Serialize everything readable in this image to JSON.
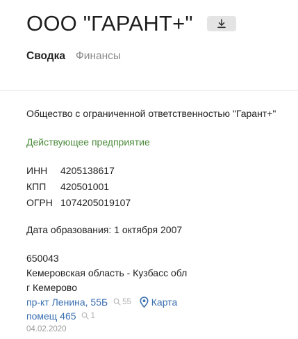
{
  "company": {
    "title": "ООО \"ГАРАНТ+\"",
    "download_icon": "download-icon"
  },
  "tabs": [
    {
      "label": "Сводка",
      "active": true
    },
    {
      "label": "Финансы",
      "active": false
    }
  ],
  "summary": {
    "full_name": "Общество с ограниченной ответственностью \"Гарант+\"",
    "status": "Действующее предприятие",
    "status_color": "#4a8a3a",
    "registration": [
      {
        "key": "ИНН",
        "value": "4205138617"
      },
      {
        "key": "КПП",
        "value": "420501001"
      },
      {
        "key": "ОГРН",
        "value": "1074205019107"
      }
    ],
    "founded": "Дата образования: 1 октября 2007"
  },
  "address": {
    "zip": "650043",
    "region": "Кемеровская область - Кузбасс обл",
    "city": "г Кемерово",
    "street": "пр-кт Ленина, 55Б",
    "street_count": "55",
    "map_label": "Карта",
    "office": "помещ 465",
    "office_count": "1",
    "date": "04.02.2020"
  },
  "colors": {
    "link": "#3a6fb0",
    "accent_green": "#4a8a3a"
  }
}
